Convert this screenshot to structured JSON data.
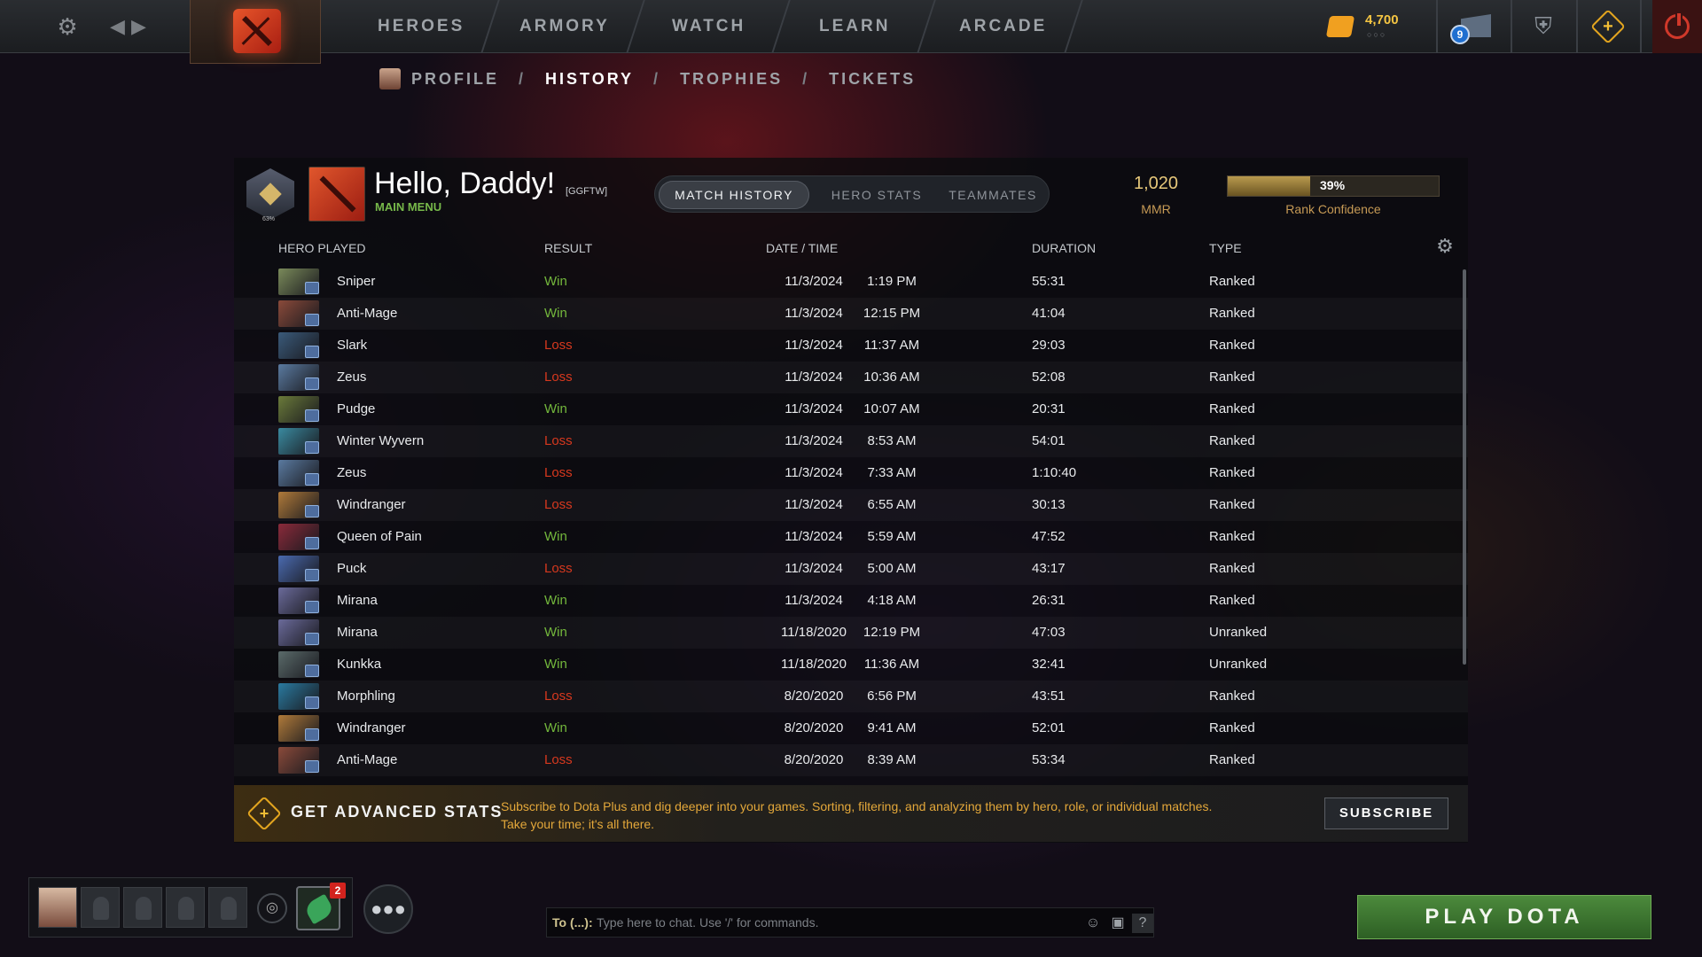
{
  "topbar": {
    "nav": [
      "HEROES",
      "ARMORY",
      "WATCH",
      "LEARN",
      "ARCADE"
    ],
    "gold": "4,700",
    "gold_dots": "○○○",
    "mail_count": "9"
  },
  "subnav": {
    "items": [
      "PROFILE",
      "HISTORY",
      "TROPHIES",
      "TICKETS"
    ],
    "separator": "/",
    "active": "HISTORY"
  },
  "header": {
    "badge_pct": "63%",
    "greeting": "Hello, Daddy!",
    "tag": "[GGFTW]",
    "subtitle": "MAIN MENU",
    "tabs": [
      "MATCH HISTORY",
      "HERO STATS",
      "TEAMMATES"
    ],
    "active_tab": "MATCH HISTORY",
    "mmr_value": "1,020",
    "mmr_label": "MMR",
    "confidence_value": "39%",
    "confidence_fraction": 0.39,
    "confidence_label": "Rank Confidence"
  },
  "table": {
    "columns": [
      "HERO PLAYED",
      "RESULT",
      "DATE / TIME",
      "DURATION",
      "TYPE"
    ],
    "rows": [
      {
        "hero": "Sniper",
        "result": "Win",
        "date": "11/3/2024",
        "time": "1:19 PM",
        "duration": "55:31",
        "type": "Ranked"
      },
      {
        "hero": "Anti-Mage",
        "result": "Win",
        "date": "11/3/2024",
        "time": "12:15 PM",
        "duration": "41:04",
        "type": "Ranked"
      },
      {
        "hero": "Slark",
        "result": "Loss",
        "date": "11/3/2024",
        "time": "11:37 AM",
        "duration": "29:03",
        "type": "Ranked"
      },
      {
        "hero": "Zeus",
        "result": "Loss",
        "date": "11/3/2024",
        "time": "10:36 AM",
        "duration": "52:08",
        "type": "Ranked"
      },
      {
        "hero": "Pudge",
        "result": "Win",
        "date": "11/3/2024",
        "time": "10:07 AM",
        "duration": "20:31",
        "type": "Ranked"
      },
      {
        "hero": "Winter Wyvern",
        "result": "Loss",
        "date": "11/3/2024",
        "time": "8:53 AM",
        "duration": "54:01",
        "type": "Ranked"
      },
      {
        "hero": "Zeus",
        "result": "Loss",
        "date": "11/3/2024",
        "time": "7:33 AM",
        "duration": "1:10:40",
        "type": "Ranked"
      },
      {
        "hero": "Windranger",
        "result": "Loss",
        "date": "11/3/2024",
        "time": "6:55 AM",
        "duration": "30:13",
        "type": "Ranked"
      },
      {
        "hero": "Queen of Pain",
        "result": "Win",
        "date": "11/3/2024",
        "time": "5:59 AM",
        "duration": "47:52",
        "type": "Ranked"
      },
      {
        "hero": "Puck",
        "result": "Loss",
        "date": "11/3/2024",
        "time": "5:00 AM",
        "duration": "43:17",
        "type": "Ranked"
      },
      {
        "hero": "Mirana",
        "result": "Win",
        "date": "11/3/2024",
        "time": "4:18 AM",
        "duration": "26:31",
        "type": "Ranked"
      },
      {
        "hero": "Mirana",
        "result": "Win",
        "date": "11/18/2020",
        "time": "12:19 PM",
        "duration": "47:03",
        "type": "Unranked"
      },
      {
        "hero": "Kunkka",
        "result": "Win",
        "date": "11/18/2020",
        "time": "11:36 AM",
        "duration": "32:41",
        "type": "Unranked"
      },
      {
        "hero": "Morphling",
        "result": "Loss",
        "date": "8/20/2020",
        "time": "6:56 PM",
        "duration": "43:51",
        "type": "Ranked"
      },
      {
        "hero": "Windranger",
        "result": "Win",
        "date": "8/20/2020",
        "time": "9:41 AM",
        "duration": "52:01",
        "type": "Ranked"
      },
      {
        "hero": "Anti-Mage",
        "result": "Loss",
        "date": "8/20/2020",
        "time": "8:39 AM",
        "duration": "53:34",
        "type": "Ranked"
      }
    ]
  },
  "promo": {
    "title": "GET ADVANCED STATS",
    "description": "Subscribe to Dota Plus and dig deeper into your games. Sorting, filtering, and analyzing them by hero, role, or individual matches. Take your time; it's all there.",
    "button": "SUBSCRIBE"
  },
  "bottom": {
    "inventory_badge": "2",
    "chat_to": "To (...):",
    "chat_placeholder": "Type here to chat. Use '/' for commands.",
    "play_button": "PLAY DOTA"
  },
  "colors": {
    "win": "#73b73c",
    "loss": "#d6381e",
    "accent_gold": "#e6c77a",
    "play_green": "#4c8a3c"
  }
}
